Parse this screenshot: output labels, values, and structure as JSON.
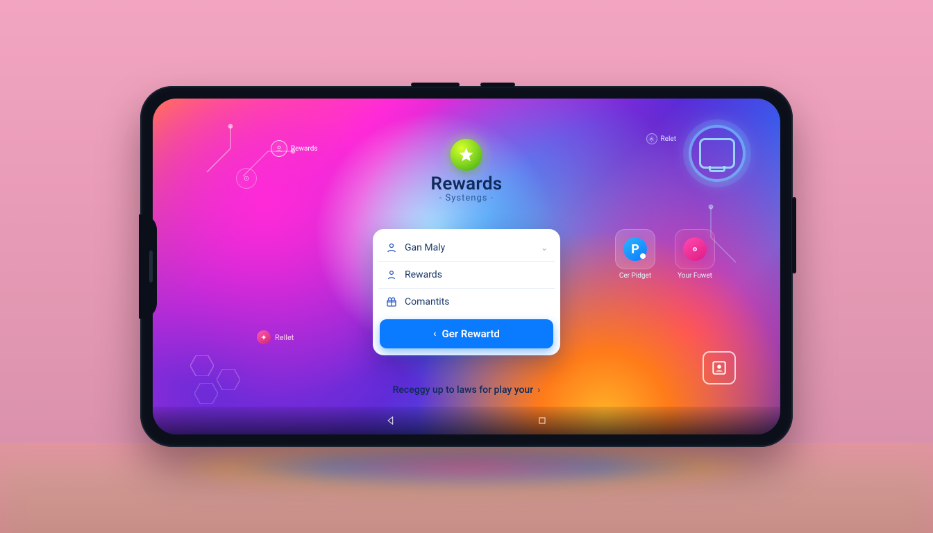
{
  "header": {
    "title": "Rewards",
    "subtitle": "Systengs"
  },
  "chips": {
    "top_left_label": "Rewards",
    "top_right_label": "Relet",
    "bottom_left_label": "Rellet"
  },
  "card": {
    "items": [
      {
        "icon": "user",
        "label": "Gan Maly"
      },
      {
        "icon": "person",
        "label": "Rewards"
      },
      {
        "icon": "gift",
        "label": "Comantits"
      }
    ],
    "cta_label": "Ger Rewartd"
  },
  "tiles": [
    {
      "kind": "p",
      "label": "Cer Pidget"
    },
    {
      "kind": "o",
      "label": "Your Fuwet"
    }
  ],
  "promo": "Receggy up to laws for play your",
  "icons": {
    "profile_big": "monitor-icon",
    "contact": "contact-card-icon"
  },
  "colors": {
    "accent_blue": "#0a7bff",
    "logo_green": "#7ed321",
    "magenta": "#ff2ad8",
    "cyan": "#36b8ff",
    "orange": "#ffb327"
  }
}
